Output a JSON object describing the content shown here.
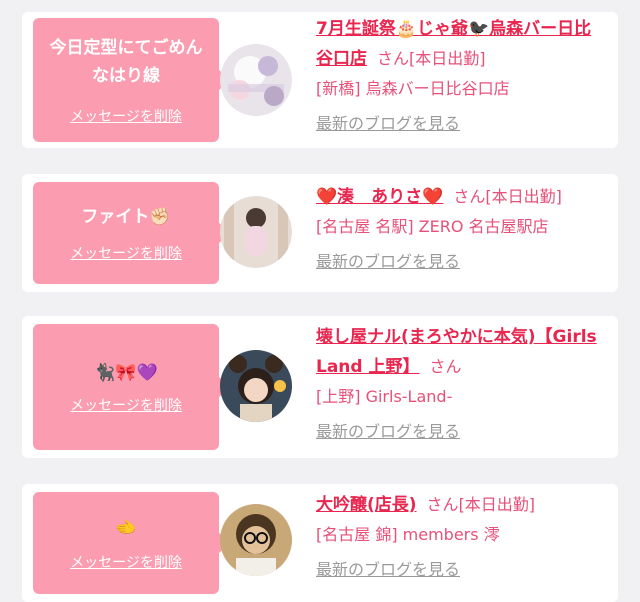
{
  "colors": {
    "bubble": "#fc9cb0",
    "name": "#e8264f",
    "text": "#e8507a",
    "blog_link": "#9a9a9a",
    "background": "#f1f1f3"
  },
  "delete_label": "メッセージを削除",
  "blog_label": "最新のブログを見る",
  "san_label": "さん",
  "items": [
    {
      "message": "今日定型にてごめんなはり線",
      "name": "7月生誕祭🎂じゃ爺🐦‍⬛烏森バー日比谷口店",
      "status": "[本日出勤]",
      "shop": "[新橋] 烏森バー日比谷口店"
    },
    {
      "message": "ファイト✊🏻",
      "name": "❤️湊　ありさ❤️",
      "status": "[本日出勤]",
      "shop": "[名古屋 名駅] ZERO 名古屋駅店"
    },
    {
      "message": "🐈‍⬛🎀💜",
      "name": "壊し屋ナル(まろやかに本気)【Girls Land 上野】",
      "status": "",
      "shop": "[上野] Girls-Land-"
    },
    {
      "message": "🫲",
      "name": "大吟醸(店長)",
      "status": "[本日出勤]",
      "shop": "[名古屋 錦] members 澪"
    }
  ]
}
